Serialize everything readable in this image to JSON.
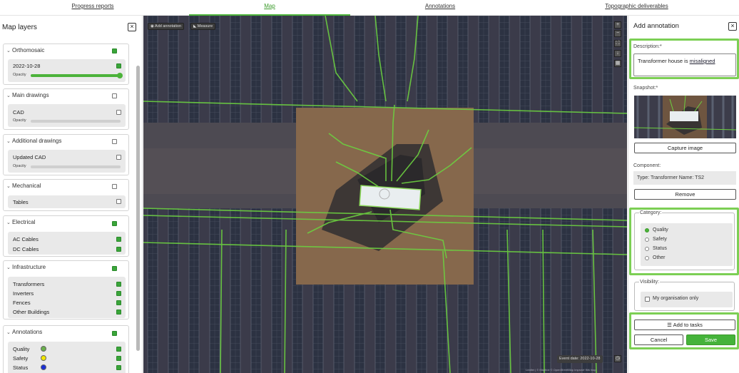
{
  "nav": {
    "tabs": [
      {
        "label": "Progress reports",
        "active": false
      },
      {
        "label": "Map",
        "active": true
      },
      {
        "label": "Annotations",
        "active": false
      },
      {
        "label": "Topographic deliverables",
        "active": false
      }
    ]
  },
  "left_panel": {
    "title": "Map layers",
    "close_label": "×",
    "opacity_label": "Opacity",
    "groups": [
      {
        "label": "Orthomosaic",
        "checked": true,
        "items": [
          {
            "label": "2022-10-28",
            "checked": true,
            "opacity": 1.0
          }
        ]
      },
      {
        "label": "Main drawings",
        "checked": false,
        "items": [
          {
            "label": "CAD",
            "checked": false,
            "opacity": 0
          }
        ]
      },
      {
        "label": "Additional drawings",
        "checked": false,
        "items": [
          {
            "label": "Updated CAD",
            "checked": false,
            "opacity": 0
          }
        ]
      },
      {
        "label": "Mechanical",
        "checked": false,
        "items": [
          {
            "label": "Tables",
            "checked": false
          }
        ]
      },
      {
        "label": "Electrical",
        "checked": true,
        "items": [
          {
            "label": "AC Cables",
            "checked": true
          },
          {
            "label": "DC Cables",
            "checked": true
          }
        ]
      },
      {
        "label": "Infrastructure",
        "checked": true,
        "items": [
          {
            "label": "Transformers",
            "checked": true
          },
          {
            "label": "Inverters",
            "checked": true
          },
          {
            "label": "Fences",
            "checked": true
          },
          {
            "label": "Other Buildings",
            "checked": true
          }
        ]
      },
      {
        "label": "Annotations",
        "checked": true,
        "items": [
          {
            "label": "Quality",
            "checked": true,
            "color": "#6ab04c"
          },
          {
            "label": "Safety",
            "checked": true,
            "color": "#f2e600"
          },
          {
            "label": "Status",
            "checked": true,
            "color": "#1a2fd6"
          }
        ]
      }
    ]
  },
  "map": {
    "add_annotation_label": "Add annotation",
    "measure_label": "Measure",
    "zoom_in": "+",
    "zoom_out": "−",
    "event_date": "Event date: 2022-10-28",
    "attribution": "Leaflet | © Mapbox © OpenStreetMap  Improve this map",
    "colors": {
      "cable": "#6cd040",
      "ground": "#8a6a4a",
      "panel": "#2b3140"
    }
  },
  "right_panel": {
    "title": "Add annotation",
    "close_label": "×",
    "description_label": "Description:*",
    "description_text": "Transformer house is ",
    "description_underlined": "misaligned",
    "snapshot_label": "Snapshot:*",
    "capture_button": "Capture image",
    "component_label": "Component:",
    "component_value": "Type:  Transformer  Name:  TS2",
    "remove_button": "Remove",
    "category_label": "Category:",
    "categories": [
      {
        "label": "Quality",
        "selected": true
      },
      {
        "label": "Safety",
        "selected": false
      },
      {
        "label": "Status",
        "selected": false
      },
      {
        "label": "Other",
        "selected": false
      }
    ],
    "visibility_label": "Visibility:",
    "visibility_option": "My organisation only",
    "add_to_tasks_button": "Add to tasks",
    "cancel_button": "Cancel",
    "save_button": "Save",
    "highlight_color": "#7ccf54"
  }
}
